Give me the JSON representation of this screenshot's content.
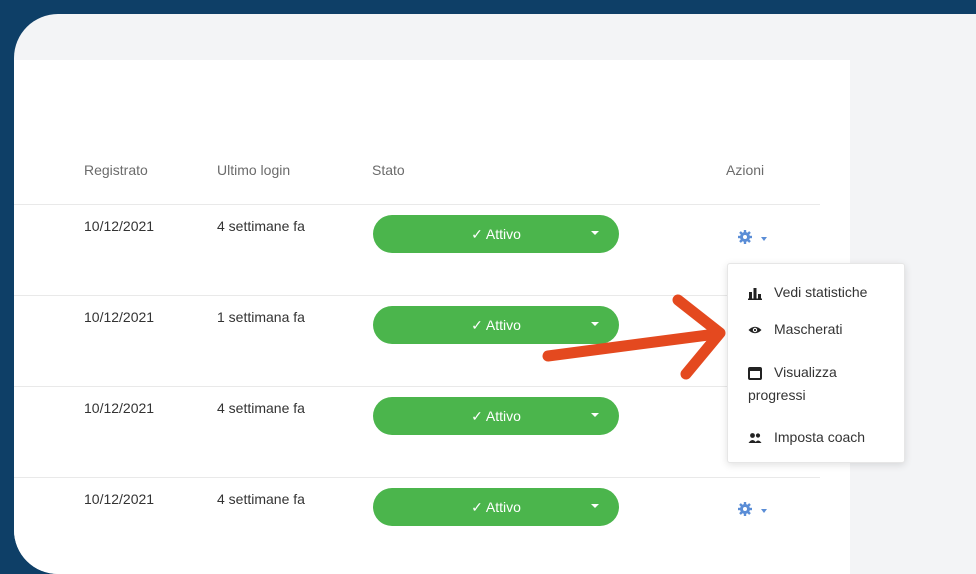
{
  "columns": {
    "registered": "Registrato",
    "last_login": "Ultimo login",
    "status": "Stato",
    "actions": "Azioni"
  },
  "rows": [
    {
      "registered": "10/12/2021",
      "last_login": "4 settimane fa",
      "status": "✓ Attivo"
    },
    {
      "registered": "10/12/2021",
      "last_login": "1 settimana fa",
      "status": "✓ Attivo"
    },
    {
      "registered": "10/12/2021",
      "last_login": "4 settimane fa",
      "status": "✓ Attivo"
    },
    {
      "registered": "10/12/2021",
      "last_login": "4 settimane fa",
      "status": "✓ Attivo"
    }
  ],
  "actions_menu": {
    "items": [
      {
        "label": "Vedi statistiche",
        "icon": "bar-chart-icon"
      },
      {
        "label": "Mascherati",
        "icon": "eye-icon"
      },
      {
        "label": "Visualizza",
        "label2": "progressi",
        "icon": "calendar-icon"
      },
      {
        "label": "Imposta coach",
        "icon": "users-icon"
      }
    ]
  },
  "colors": {
    "background": "#0e3f67",
    "status_active": "#4bb54c",
    "accent_icon": "#5a8dd6",
    "annotation_arrow": "#e4491f"
  }
}
